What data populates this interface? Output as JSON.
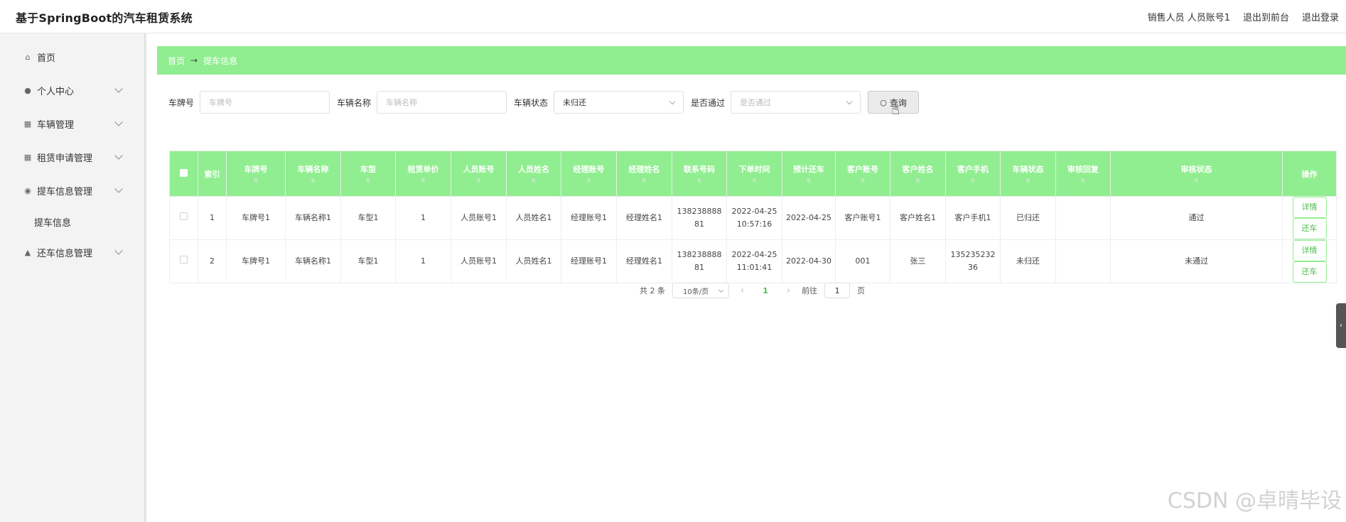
{
  "header": {
    "app_title": "基于SpringBoot的汽车租赁系统",
    "user_info": "销售人员 人员账号1",
    "back_front": "退出到前台",
    "logout": "退出登录"
  },
  "sidebar": {
    "home": "首页",
    "personal": "个人中心",
    "vehicle": "车辆管理",
    "rental": "租赁申请管理",
    "pickup": "提车信息管理",
    "pickup_sub": "提车信息",
    "return": "还车信息管理"
  },
  "breadcrumb": {
    "home": "首页",
    "arrow": "→",
    "current": "提车信息"
  },
  "filters": {
    "plate_label": "车牌号",
    "plate_placeholder": "车牌号",
    "name_label": "车辆名称",
    "name_placeholder": "车辆名称",
    "status_label": "车辆状态",
    "status_value": "未归还",
    "pass_label": "是否通过",
    "pass_placeholder": "是否通过",
    "search_label": "查询"
  },
  "table": {
    "columns": [
      "索引",
      "车牌号",
      "车辆名称",
      "车型",
      "租赁单价",
      "人员账号",
      "人员姓名",
      "经理账号",
      "经理姓名",
      "联系号码",
      "下单时间",
      "预计还车",
      "客户账号",
      "客户姓名",
      "客户手机",
      "车辆状态",
      "审核回复",
      "审核状态",
      "操作"
    ],
    "rows": [
      {
        "index": "1",
        "plate": "车牌号1",
        "name": "车辆名称1",
        "model": "车型1",
        "price": "1",
        "staff_acc": "人员账号1",
        "staff_name": "人员姓名1",
        "mgr_acc": "经理账号1",
        "mgr_name": "经理姓名1",
        "phone": "13823888881",
        "order_time": "2022-04-25 10:57:16",
        "return_date": "2022-04-25",
        "cust_acc": "客户账号1",
        "cust_name": "客户姓名1",
        "cust_phone": "客户手机1",
        "car_status": "已归还",
        "reply": "",
        "audit": "通过",
        "detail": "详情",
        "return_btn": "还车"
      },
      {
        "index": "2",
        "plate": "车牌号1",
        "name": "车辆名称1",
        "model": "车型1",
        "price": "1",
        "staff_acc": "人员账号1",
        "staff_name": "人员姓名1",
        "mgr_acc": "经理账号1",
        "mgr_name": "经理姓名1",
        "phone": "13823888881",
        "order_time": "2022-04-25 11:01:41",
        "return_date": "2022-04-30",
        "cust_acc": "001",
        "cust_name": "张三",
        "cust_phone": "13523523236",
        "car_status": "未归还",
        "reply": "",
        "audit": "未通过",
        "detail": "详情",
        "return_btn": "还车"
      }
    ]
  },
  "pager": {
    "total": "共 2 条",
    "size": "10条/页",
    "prev": "‹",
    "current": "1",
    "next": "›",
    "goto": "前往",
    "page_input": "1",
    "page_unit": "页"
  },
  "watermark": "CSDN @卓晴毕设",
  "colors": {
    "accent": "#90ee90"
  }
}
